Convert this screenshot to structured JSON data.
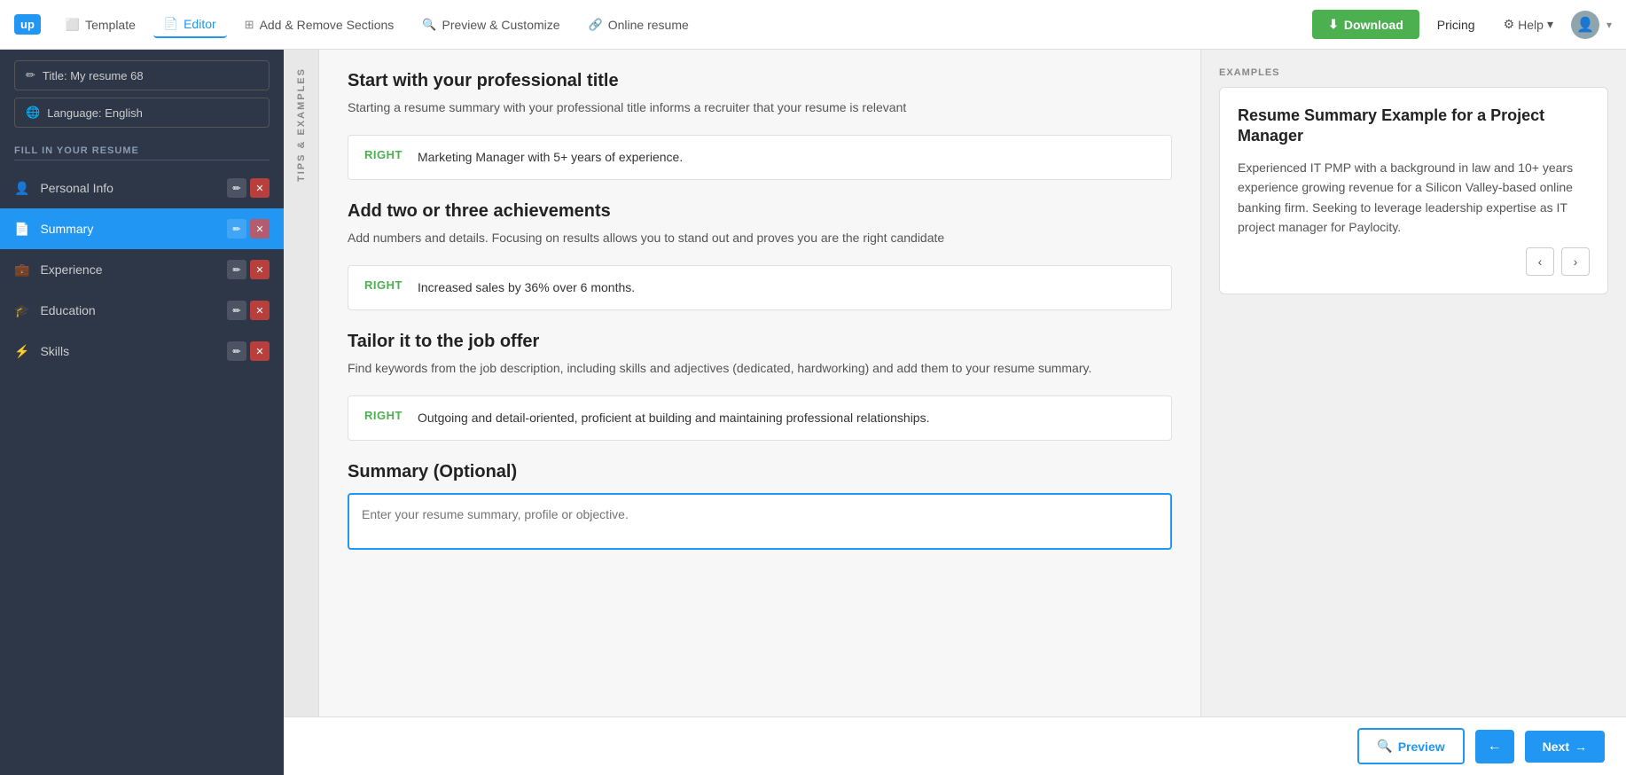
{
  "logo": "up",
  "nav": {
    "template": "Template",
    "editor": "Editor",
    "add_remove": "Add & Remove Sections",
    "preview": "Preview & Customize",
    "online_resume": "Online resume",
    "download": "Download",
    "pricing": "Pricing",
    "help": "Help"
  },
  "sidebar": {
    "title_btn": "Title: My resume 68",
    "language_btn": "Language: English",
    "fill_label": "FILL IN YOUR RESUME",
    "items": [
      {
        "id": "personal-info",
        "label": "Personal Info",
        "icon": "👤",
        "active": false
      },
      {
        "id": "summary",
        "label": "Summary",
        "icon": "📄",
        "active": true
      },
      {
        "id": "experience",
        "label": "Experience",
        "icon": "💼",
        "active": false
      },
      {
        "id": "education",
        "label": "Education",
        "icon": "🎓",
        "active": false
      },
      {
        "id": "skills",
        "label": "Skills",
        "icon": "⚡",
        "active": false
      }
    ]
  },
  "tips_label": "TIPS & EXAMPLES",
  "sections": [
    {
      "heading": "Start with your professional title",
      "desc": "Starting a resume summary with your professional title informs a recruiter that your resume is relevant",
      "example": {
        "badge": "RIGHT",
        "text": "Marketing Manager with 5+ years of experience."
      }
    },
    {
      "heading": "Add two or three achievements",
      "desc": "Add numbers and details. Focusing on results allows you to stand out and proves you are the right candidate",
      "example": {
        "badge": "RIGHT",
        "text": "Increased sales by 36% over 6 months."
      }
    },
    {
      "heading": "Tailor it to the job offer",
      "desc": "Find keywords from the job description, including skills and adjectives (dedicated, hardworking) and add them to your resume summary.",
      "example": {
        "badge": "RIGHT",
        "text": "Outgoing and detail-oriented, proficient at building and maintaining professional relationships."
      }
    }
  ],
  "examples_panel": {
    "label": "EXAMPLES",
    "card": {
      "title": "Resume Summary Example for a Project Manager",
      "body": "Experienced IT PMP with a background in law and 10+ years experience growing revenue for a Silicon Valley-based online banking firm. Seeking to leverage leadership expertise as IT project manager for Paylocity."
    }
  },
  "optional_section": {
    "title": "Summary (Optional)",
    "placeholder": "Enter your resume summary, profile or objective."
  },
  "bottom_bar": {
    "preview": "Preview",
    "next": "Next"
  }
}
